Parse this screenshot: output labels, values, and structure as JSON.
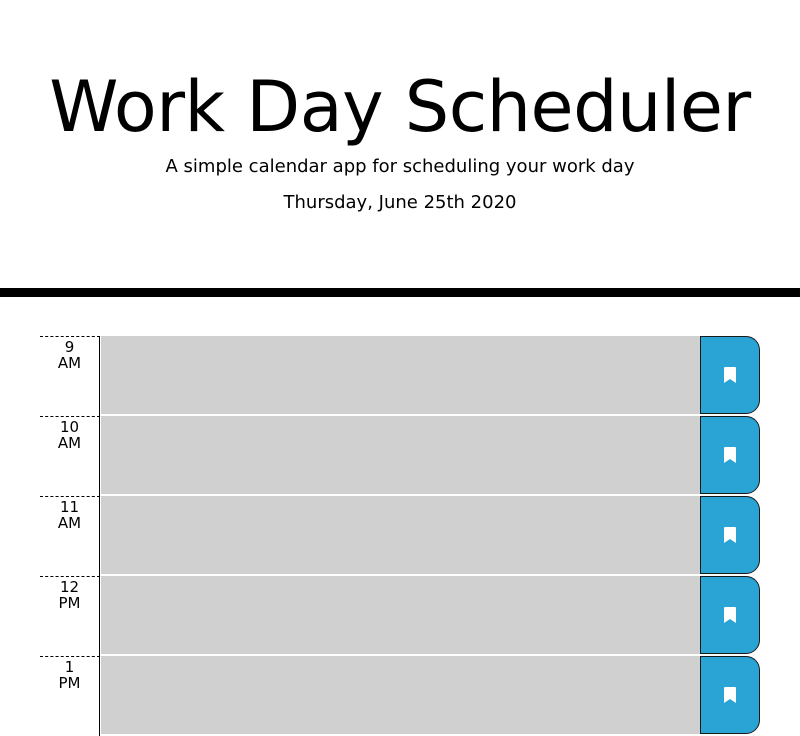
{
  "header": {
    "title": "Work Day Scheduler",
    "subtitle": "A simple calendar app for scheduling your work day",
    "current_day": "Thursday, June 25th 2020"
  },
  "timeblocks": [
    {
      "hour": "9",
      "period": "AM",
      "text": "",
      "save_icon": "bookmark-icon"
    },
    {
      "hour": "10",
      "period": "AM",
      "text": "",
      "save_icon": "bookmark-icon"
    },
    {
      "hour": "11",
      "period": "AM",
      "text": "",
      "save_icon": "bookmark-icon"
    },
    {
      "hour": "12",
      "period": "PM",
      "text": "",
      "save_icon": "bookmark-icon"
    },
    {
      "hour": "1",
      "period": "PM",
      "text": "",
      "save_icon": "bookmark-icon"
    }
  ],
  "colors": {
    "block_past": "#d0d0d0",
    "save_button": "#2aa4d5",
    "divider": "#000000"
  }
}
